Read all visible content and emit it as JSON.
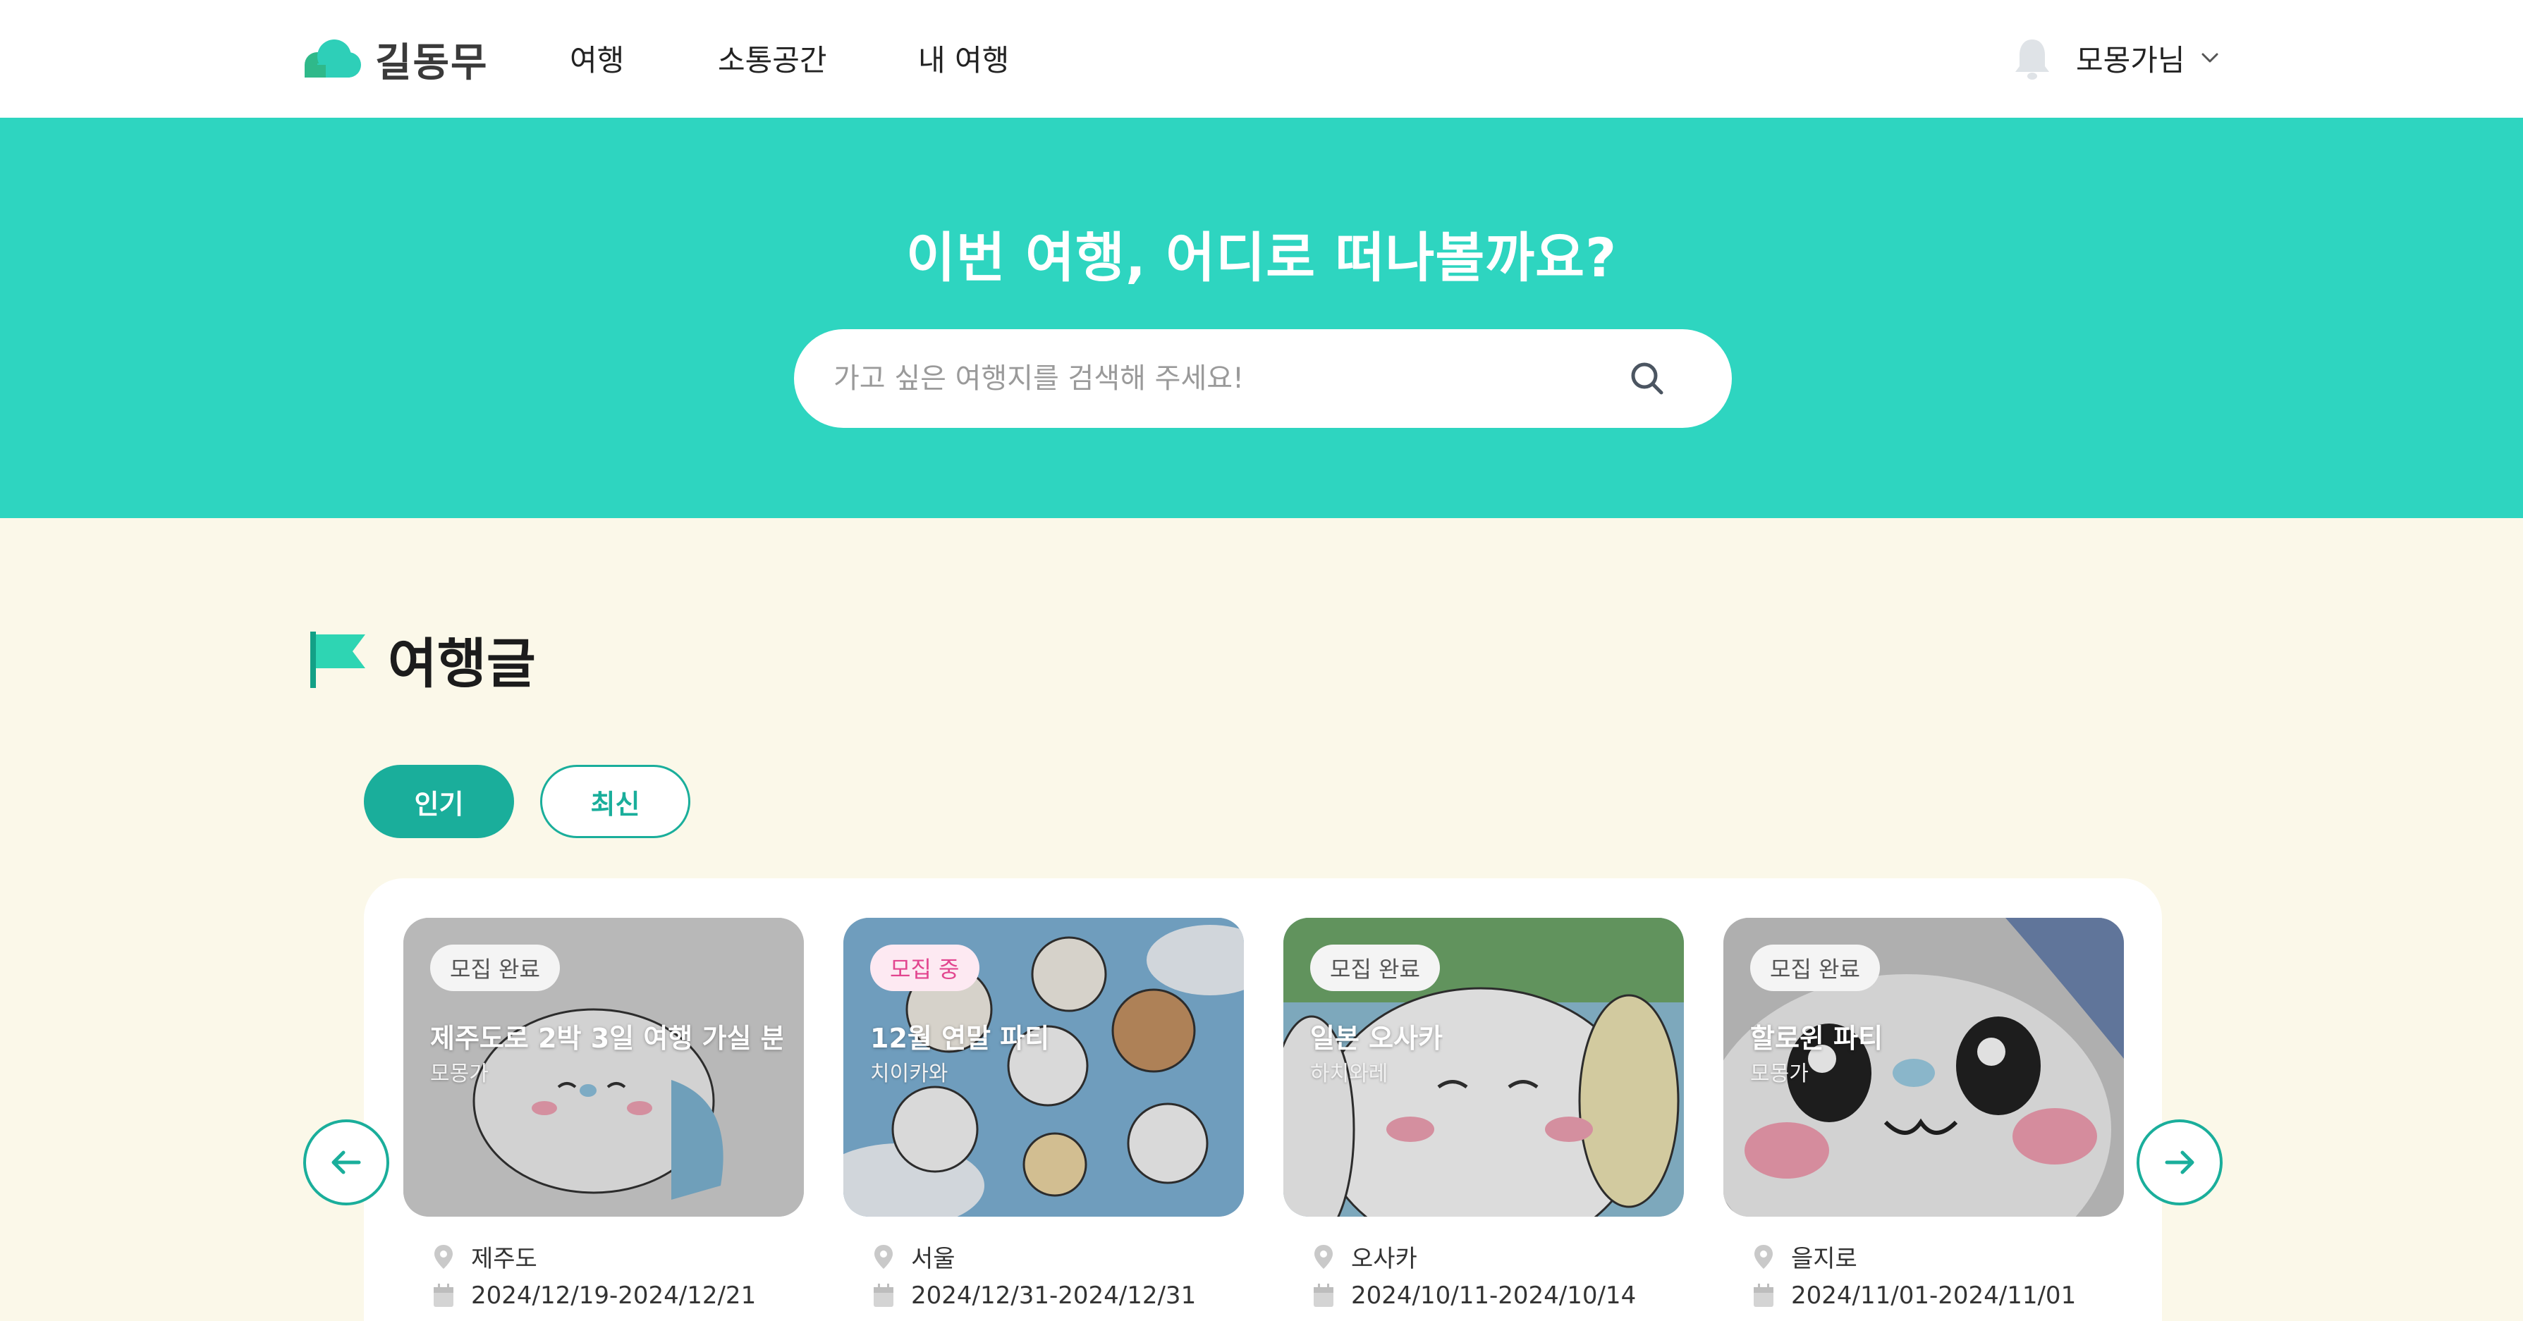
{
  "header": {
    "logo_text": "길동무",
    "nav": [
      "여행",
      "소통공간",
      "내 여행"
    ],
    "user_name": "모몽가님"
  },
  "hero": {
    "title": "이번 여행, 어디로 떠나볼까요?",
    "search_placeholder": "가고 싶은 여행지를 검색해 주세요!"
  },
  "section": {
    "title": "여행글",
    "filters": [
      "인기",
      "최신"
    ],
    "active_filter": "인기"
  },
  "cards": [
    {
      "status": "모집 완료",
      "title": "제주도로 2박 3일 여행 가실 분",
      "author": "모몽가",
      "location": "제주도",
      "dates": "2024/12/19-2024/12/21"
    },
    {
      "status": "모집 중",
      "title": "12월 연말 파티",
      "author": "치이카와",
      "location": "서울",
      "dates": "2024/12/31-2024/12/31"
    },
    {
      "status": "모집 완료",
      "title": "일본 오사카",
      "author": "하치와레",
      "location": "오사카",
      "dates": "2024/10/11-2024/10/14"
    },
    {
      "status": "모집 완료",
      "title": "할로윈 파티",
      "author": "모몽가",
      "location": "을지로",
      "dates": "2024/11/01-2024/11/01"
    }
  ],
  "colors": {
    "hero_bg": "#2ed5c0",
    "accent": "#1aae9b",
    "page_bg": "#fbf8e9",
    "recruiting_badge": "#e2458f"
  },
  "icons": [
    "cloud-logo-icon",
    "bell-icon",
    "chevron-down-icon",
    "search-icon",
    "flag-icon",
    "arrow-left-icon",
    "arrow-right-icon",
    "location-pin-icon",
    "calendar-icon"
  ]
}
